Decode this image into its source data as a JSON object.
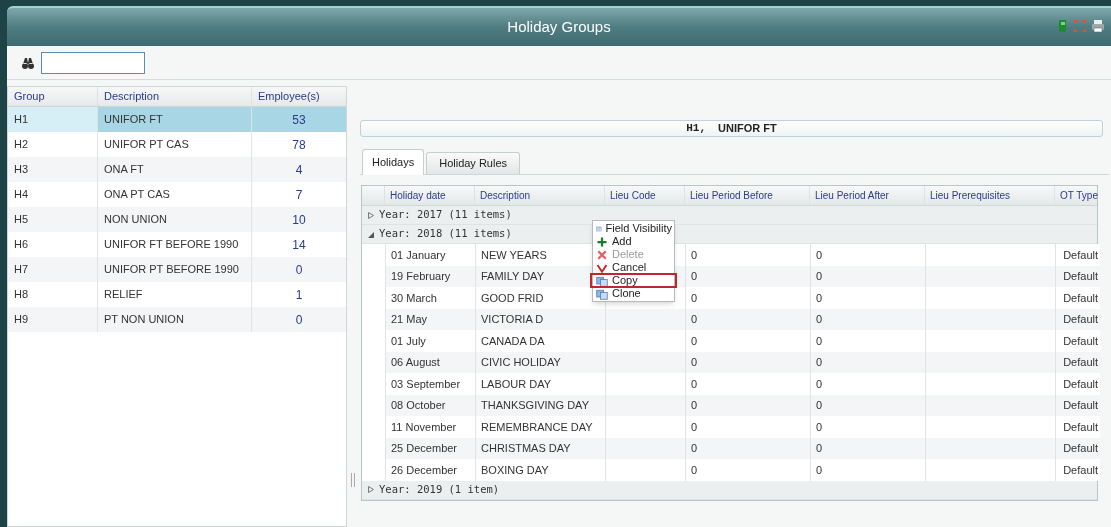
{
  "window": {
    "title": "Holiday Groups"
  },
  "groups": {
    "columns": [
      "Group",
      "Description",
      "Employee(s)"
    ],
    "rows": [
      {
        "group": "H1",
        "description": "UNIFOR FT",
        "employees": "53",
        "selected": true
      },
      {
        "group": "H2",
        "description": "UNIFOR PT CAS",
        "employees": "78",
        "selected": false
      },
      {
        "group": "H3",
        "description": "ONA FT",
        "employees": "4",
        "selected": false
      },
      {
        "group": "H4",
        "description": "ONA PT CAS",
        "employees": "7",
        "selected": false
      },
      {
        "group": "H5",
        "description": "NON UNION",
        "employees": "10",
        "selected": false
      },
      {
        "group": "H6",
        "description": "UNIFOR FT BEFORE 1990",
        "employees": "14",
        "selected": false
      },
      {
        "group": "H7",
        "description": "UNIFOR PT BEFORE 1990",
        "employees": "0",
        "selected": false
      },
      {
        "group": "H8",
        "description": "RELIEF",
        "employees": "1",
        "selected": false
      },
      {
        "group": "H9",
        "description": "PT NON UNION",
        "employees": "0",
        "selected": false
      }
    ]
  },
  "detail_header": {
    "code": "H1,",
    "name": "UNIFOR FT"
  },
  "tabs": [
    {
      "label": "Holidays",
      "selected": true
    },
    {
      "label": "Holiday Rules",
      "selected": false
    }
  ],
  "holidays": {
    "columns": [
      "Holiday date",
      "Description",
      "Lieu Code",
      "Lieu Period Before",
      "Lieu Period After",
      "Lieu Prerequisites",
      "OT Type"
    ],
    "groups": [
      {
        "label": "Year: 2017 (11 items)",
        "expanded": false
      },
      {
        "label": "Year: 2018 (11 items)",
        "expanded": true,
        "rows": [
          {
            "date": "01 January",
            "description": "NEW YEARS",
            "lieu_period_before": "0",
            "lieu_period_after": "0",
            "ot_type": "Default"
          },
          {
            "date": "19 February",
            "description": "FAMILY DAY",
            "lieu_period_before": "0",
            "lieu_period_after": "0",
            "ot_type": "Default"
          },
          {
            "date": "30 March",
            "description": "GOOD FRID",
            "lieu_period_before": "0",
            "lieu_period_after": "0",
            "ot_type": "Default"
          },
          {
            "date": "21 May",
            "description": "VICTORIA D",
            "lieu_period_before": "0",
            "lieu_period_after": "0",
            "ot_type": "Default"
          },
          {
            "date": "01 July",
            "description": "CANADA DA",
            "lieu_period_before": "0",
            "lieu_period_after": "0",
            "ot_type": "Default"
          },
          {
            "date": "06 August",
            "description": "CIVIC HOLIDAY",
            "lieu_period_before": "0",
            "lieu_period_after": "0",
            "ot_type": "Default"
          },
          {
            "date": "03 September",
            "description": "LABOUR DAY",
            "lieu_period_before": "0",
            "lieu_period_after": "0",
            "ot_type": "Default"
          },
          {
            "date": "08 October",
            "description": "THANKSGIVING DAY",
            "lieu_period_before": "0",
            "lieu_period_after": "0",
            "ot_type": "Default"
          },
          {
            "date": "11 November",
            "description": "REMEMBRANCE DAY",
            "lieu_period_before": "0",
            "lieu_period_after": "0",
            "ot_type": "Default"
          },
          {
            "date": "25 December",
            "description": "CHRISTMAS DAY",
            "lieu_period_before": "0",
            "lieu_period_after": "0",
            "ot_type": "Default"
          },
          {
            "date": "26 December",
            "description": "BOXING DAY",
            "lieu_period_before": "0",
            "lieu_period_after": "0",
            "ot_type": "Default"
          }
        ]
      },
      {
        "label": "Year: 2019 (1 item)",
        "expanded": false
      }
    ]
  },
  "context_menu": {
    "items": [
      {
        "label": "Field Visibility",
        "kind": "columns",
        "disabled": false,
        "outlined": false
      },
      {
        "label": "Add",
        "kind": "add",
        "disabled": false,
        "outlined": false
      },
      {
        "label": "Delete",
        "kind": "delete",
        "disabled": true,
        "outlined": false
      },
      {
        "label": "Cancel",
        "kind": "cancel",
        "disabled": false,
        "outlined": false
      },
      {
        "label": "Copy",
        "kind": "copy",
        "disabled": false,
        "outlined": true
      },
      {
        "label": "Clone",
        "kind": "clone",
        "disabled": false,
        "outlined": false
      }
    ]
  }
}
